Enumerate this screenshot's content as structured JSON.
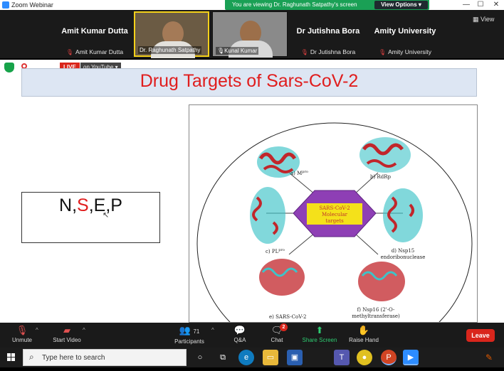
{
  "window": {
    "title": "Zoom Webinar",
    "controls": [
      "minimize-icon",
      "maximize-icon",
      "close-icon"
    ]
  },
  "banner": {
    "message": "You are viewing Dr. Raghunath Satpathy's screen",
    "view_options": "View Options"
  },
  "view_button": "View",
  "participants": [
    {
      "big": "Amit Kumar Dutta",
      "label": "Amit Kumar Dutta",
      "video": false
    },
    {
      "label": "Dr. Raghunath Satpathy",
      "video": true,
      "active": true
    },
    {
      "label": "Kunal Kumar",
      "video": true
    },
    {
      "big": "Dr Jutishna Bora",
      "label": "Dr Jutishna Bora",
      "video": false
    },
    {
      "big": "Amity University",
      "label": "Amity University",
      "video": false
    }
  ],
  "live": {
    "badge": "LIVE",
    "platform": "on YouTube"
  },
  "slide": {
    "title": "Drug Targets of Sars-CoV-2",
    "proteins": [
      "N",
      "S",
      "E",
      "P"
    ],
    "separator": ",",
    "figure": {
      "center": [
        "SARS-CoV-2",
        "Molecular",
        "targets"
      ],
      "labels": {
        "mpro": "a) M",
        "mpro_sup": "pro",
        "rdrp": "b) RdRp",
        "plpro": "c) PL",
        "plpro_sup": "pro",
        "nsp15": [
          "d) Nsp15",
          "endoribonuclease"
        ],
        "sars": "e) SARS-CoV-2",
        "nsp16": [
          "f) Nsp16 (2'-O-",
          "methyltransferase)"
        ]
      },
      "colors": {
        "hexagon": "#8e3fb5",
        "label_box": "#f4e11a",
        "helix": "#c1262b",
        "sheet": "#3ec3c8"
      }
    }
  },
  "toolbar": {
    "unmute": "Unmute",
    "start_video": "Start Video",
    "participants": "Participants",
    "participant_count": "71",
    "qa": "Q&A",
    "chat": "Chat",
    "chat_badge": "2",
    "share_screen": "Share Screen",
    "raise_hand": "Raise Hand",
    "leave": "Leave"
  },
  "taskbar": {
    "search_placeholder": "Type here to search",
    "apps": [
      "cortana-icon",
      "task-view-icon",
      "edge-icon",
      "file-explorer-icon",
      "store-icon",
      "teams-icon",
      "chrome-icon",
      "powerpoint-icon",
      "zoom-icon"
    ]
  }
}
